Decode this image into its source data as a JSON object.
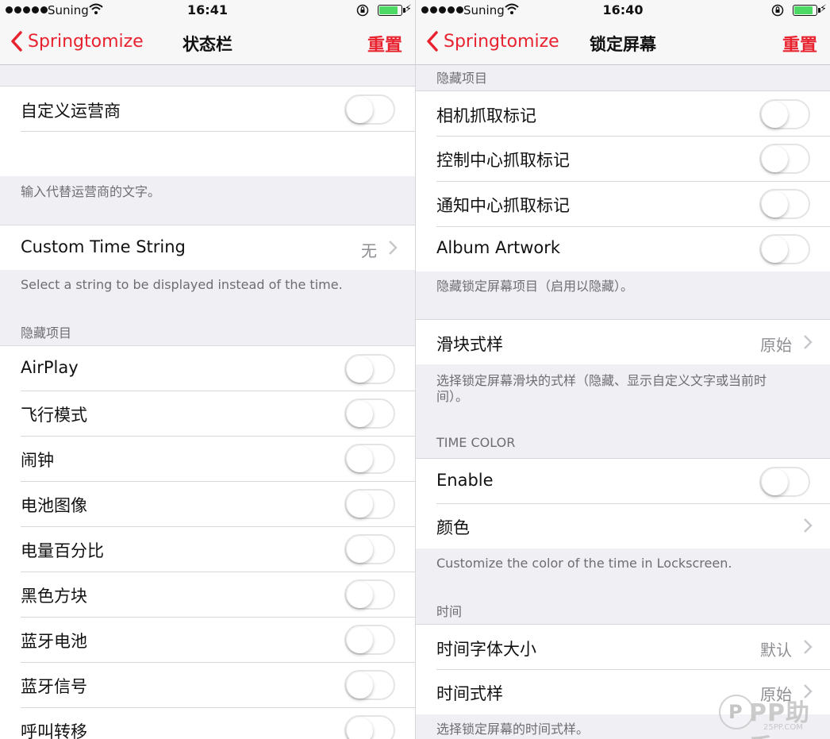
{
  "left": {
    "status": {
      "carrier": "Suning",
      "time": "16:41"
    },
    "nav": {
      "back_label": "Springtomize",
      "title": "状态栏",
      "reset_label": "重置"
    },
    "custom_carrier": {
      "label": "自定义运营商",
      "on": false
    },
    "carrier_footer": "输入代替运营商的文字。",
    "custom_time": {
      "label": "Custom Time String",
      "value": "无"
    },
    "time_footer": "Select a string to be displayed instead of the time.",
    "hide_section_header": "隐藏项目",
    "hide_items": [
      {
        "label": "AirPlay",
        "on": false
      },
      {
        "label": "飞行模式",
        "on": false
      },
      {
        "label": "闹钟",
        "on": false
      },
      {
        "label": "电池图像",
        "on": false
      },
      {
        "label": "电量百分比",
        "on": false
      },
      {
        "label": "黑色方块",
        "on": false
      },
      {
        "label": "蓝牙电池",
        "on": false
      },
      {
        "label": "蓝牙信号",
        "on": false
      },
      {
        "label": "呼叫转移",
        "on": false
      }
    ]
  },
  "right": {
    "status": {
      "carrier": "Suning",
      "time": "16:40"
    },
    "nav": {
      "back_label": "Springtomize",
      "title": "锁定屏幕",
      "reset_label": "重置"
    },
    "hide_section_header": "隐藏项目",
    "hide_items": [
      {
        "label": "相机抓取标记",
        "on": false
      },
      {
        "label": "控制中心抓取标记",
        "on": false
      },
      {
        "label": "通知中心抓取标记",
        "on": false
      },
      {
        "label": "Album Artwork",
        "on": false
      }
    ],
    "hide_footer": "隐藏锁定屏幕项目（启用以隐藏）。",
    "slider_style": {
      "label": "滑块式样",
      "value": "原始"
    },
    "slider_footer": "选择锁定屏幕滑块的式样（隐藏、显示自定义文字或当前时间）。",
    "time_color_header": "TIME COLOR",
    "enable": {
      "label": "Enable",
      "on": false
    },
    "color": {
      "label": "颜色"
    },
    "color_footer": "Customize the color of the time in Lockscreen.",
    "time_section_header": "时间",
    "time_font_size": {
      "label": "时间字体大小",
      "value": "默认"
    },
    "time_style": {
      "label": "时间式样",
      "value": "原始"
    },
    "time_footer": "选择锁定屏幕的时间式样。"
  },
  "watermark": {
    "text": "PP助手",
    "url": "25PP.COM"
  },
  "colors": {
    "accent": "#e8232f",
    "battery": "#4cd964",
    "background": "#efeff4"
  }
}
